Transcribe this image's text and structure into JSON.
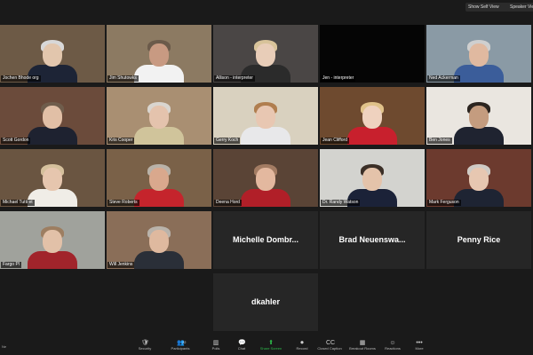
{
  "top_controls": {
    "show_self_view": "Show Self View",
    "speaker_view": "Speaker View"
  },
  "participants": [
    {
      "name": "Jochen Bhode org",
      "bg": "#6d5a46",
      "skin": "#e2c6ad",
      "hair": "#d8d8d8",
      "shirt": "#1d2436"
    },
    {
      "name": "Jim Shutowks",
      "bg": "#8c7a62",
      "skin": "#c89a82",
      "hair": "#6b5a4a",
      "shirt": "#f2f2f2"
    },
    {
      "name": "Allison - interpreter",
      "bg": "#4a4645",
      "skin": "#e8cdb8",
      "hair": "#d8c39a",
      "shirt": "#2b2b2b"
    },
    {
      "name": "Jen - interpreter",
      "bg": "#050505",
      "skin": "#050505",
      "hair": "#050505",
      "shirt": "#050505"
    },
    {
      "name": "Ned Ackerman",
      "bg": "#8a9aa5",
      "skin": "#e0b9a0",
      "hair": "#cfcfcf",
      "shirt": "#3b5d9a"
    },
    {
      "name": "Scott Gordon",
      "bg": "#6b4b3b",
      "skin": "#e1bfa6",
      "hair": "#6f5d4c",
      "shirt": "#1e2230"
    },
    {
      "name": "Kris Cooper",
      "bg": "#a98f72",
      "skin": "#e4c3ad",
      "hair": "#d9d5cf",
      "shirt": "#d0c49b"
    },
    {
      "name": "Gerry Koch",
      "bg": "#d9d1bf",
      "skin": "#e8c7b2",
      "hair": "#b07e4f",
      "shirt": "#e8e8ea"
    },
    {
      "name": "Jean Clifford",
      "bg": "#6e4a2f",
      "skin": "#efd2bf",
      "hair": "#e0c28a",
      "shirt": "#c8202d"
    },
    {
      "name": "Ben Jones",
      "bg": "#eae6e0",
      "skin": "#c49c7f",
      "hair": "#2c2520",
      "shirt": "#1f2330"
    },
    {
      "name": "Michael Tutti et",
      "bg": "#6a5541",
      "skin": "#e6c6ae",
      "hair": "#d5c09c",
      "shirt": "#f0ede7"
    },
    {
      "name": "Steve Roberts",
      "bg": "#7a6148",
      "skin": "#d9a88d",
      "hair": "#b9b2a8",
      "shirt": "#c5242c"
    },
    {
      "name": "Deena Hord",
      "bg": "#5a4436",
      "skin": "#e3b89f",
      "hair": "#a37c63",
      "shirt": "#b11f28"
    },
    {
      "name": "Dr. Randy Watson",
      "bg": "#d3d3cf",
      "skin": "#e4c3aa",
      "hair": "#3b2f27",
      "shirt": "#1b2238"
    },
    {
      "name": "Mark Ferguson",
      "bg": "#6c3a2e",
      "skin": "#e7c7b1",
      "hair": "#cfcac4",
      "shirt": "#1e2433"
    },
    {
      "name": "Fargo Pl",
      "bg": "#a0a29c",
      "skin": "#e2c1a8",
      "hair": "#9d7e61",
      "shirt": "#a1242b"
    },
    {
      "name": "Will Jenkins",
      "bg": "#8a6e58",
      "skin": "#dfb99f",
      "hair": "#b9b3ab",
      "shirt": "#2a2f38"
    }
  ],
  "text_tiles": [
    "Michelle Dombr...",
    "Brad Neuenswa...",
    "Penny Rice",
    "dkahler"
  ],
  "toolbar": {
    "left_tag": "Ne",
    "participants_count": "22",
    "items": [
      {
        "icon": "🛡",
        "label": "Security"
      },
      {
        "icon": "👥",
        "label": "Participants"
      },
      {
        "icon": "▥",
        "label": "Polls"
      },
      {
        "icon": "💬",
        "label": "Chat"
      },
      {
        "icon": "⬆",
        "label": "Share Screen"
      },
      {
        "icon": "⏺",
        "label": "Record"
      },
      {
        "icon": "CC",
        "label": "Closed Caption"
      },
      {
        "icon": "▦",
        "label": "Breakout Rooms"
      },
      {
        "icon": "☺",
        "label": "Reactions"
      },
      {
        "icon": "•••",
        "label": "More"
      }
    ]
  }
}
